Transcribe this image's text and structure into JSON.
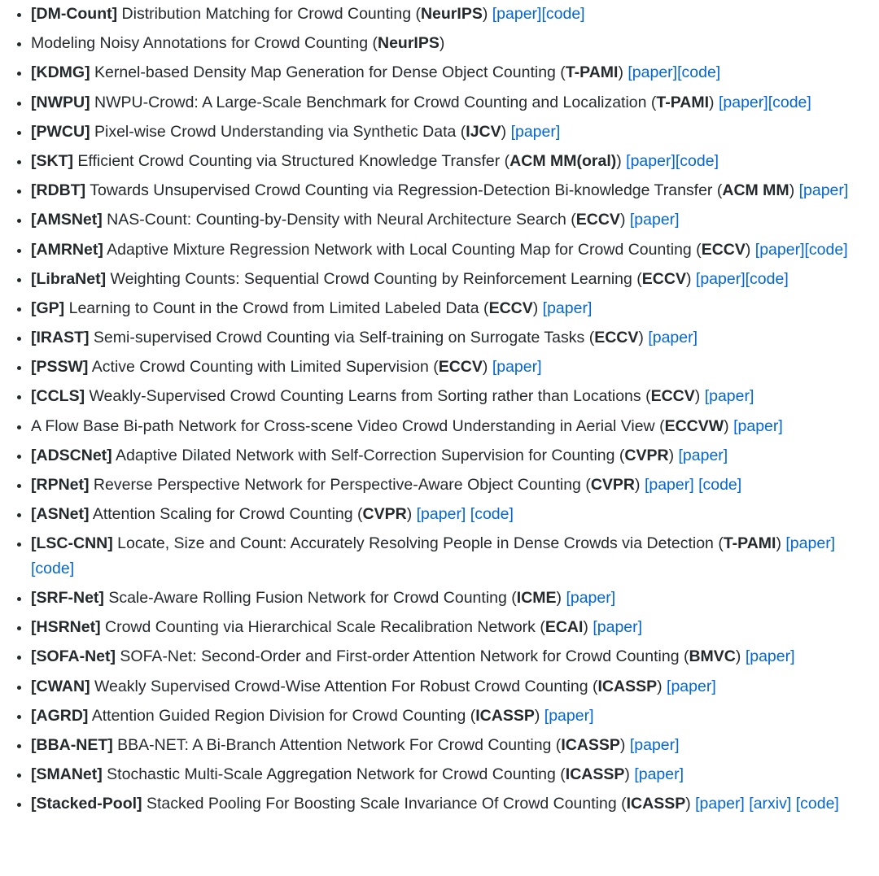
{
  "papers": [
    {
      "tag": "DM-Count",
      "title": "Distribution Matching for Crowd Counting",
      "venue": "NeurIPS",
      "links": [
        "paper",
        "code"
      ],
      "link_gap": false
    },
    {
      "tag": "",
      "title": "Modeling Noisy Annotations for Crowd Counting",
      "venue": "NeurIPS",
      "links": [],
      "link_gap": false
    },
    {
      "tag": "KDMG",
      "title": "Kernel-based Density Map Generation for Dense Object Counting",
      "venue": "T-PAMI",
      "links": [
        "paper",
        "code"
      ],
      "link_gap": false
    },
    {
      "tag": "NWPU",
      "title": "NWPU-Crowd: A Large-Scale Benchmark for Crowd Counting and Localization",
      "venue": "T-PAMI",
      "links": [
        "paper",
        "code"
      ],
      "link_gap": false
    },
    {
      "tag": "PWCU",
      "title": "Pixel-wise Crowd Understanding via Synthetic Data",
      "venue": "IJCV",
      "links": [
        "paper"
      ],
      "link_gap": false
    },
    {
      "tag": "SKT",
      "title": "Efficient Crowd Counting via Structured Knowledge Transfer",
      "venue": "ACM MM(oral)",
      "links": [
        "paper",
        "code"
      ],
      "link_gap": false
    },
    {
      "tag": "RDBT",
      "title": "Towards Unsupervised Crowd Counting via Regression-Detection Bi-knowledge Transfer",
      "venue": "ACM MM",
      "links": [
        "paper"
      ],
      "link_gap": false
    },
    {
      "tag": "AMSNet",
      "title": "NAS-Count: Counting-by-Density with Neural Architecture Search",
      "venue": "ECCV",
      "links": [
        "paper"
      ],
      "link_gap": false
    },
    {
      "tag": "AMRNet",
      "title": "Adaptive Mixture Regression Network with Local Counting Map for Crowd Counting",
      "venue": "ECCV",
      "links": [
        "paper",
        "code"
      ],
      "link_gap": false
    },
    {
      "tag": "LibraNet",
      "title": "Weighting Counts: Sequential Crowd Counting by Reinforcement Learning",
      "venue": "ECCV",
      "links": [
        "paper",
        "code"
      ],
      "link_gap": false
    },
    {
      "tag": "GP",
      "title": "Learning to Count in the Crowd from Limited Labeled Data",
      "venue": "ECCV",
      "links": [
        "paper"
      ],
      "link_gap": false
    },
    {
      "tag": "IRAST",
      "title": "Semi-supervised Crowd Counting via Self-training on Surrogate Tasks",
      "venue": "ECCV",
      "links": [
        "paper"
      ],
      "link_gap": false
    },
    {
      "tag": "PSSW",
      "title": "Active Crowd Counting with Limited Supervision",
      "venue": "ECCV",
      "links": [
        "paper"
      ],
      "link_gap": false
    },
    {
      "tag": "CCLS",
      "title": "Weakly-Supervised Crowd Counting Learns from Sorting rather than Locations",
      "venue": "ECCV",
      "links": [
        "paper"
      ],
      "link_gap": false
    },
    {
      "tag": "",
      "title": "A Flow Base Bi-path Network for Cross-scene Video Crowd Understanding in Aerial View",
      "venue": "ECCVW",
      "links": [
        "paper"
      ],
      "link_gap": false
    },
    {
      "tag": "ADSCNet",
      "title": "Adaptive Dilated Network with Self-Correction Supervision for Counting",
      "venue": "CVPR",
      "links": [
        "paper"
      ],
      "link_gap": false
    },
    {
      "tag": "RPNet",
      "title": "Reverse Perspective Network for Perspective-Aware Object Counting",
      "venue": "CVPR",
      "links": [
        "paper",
        "code"
      ],
      "link_gap": true
    },
    {
      "tag": "ASNet",
      "title": "Attention Scaling for Crowd Counting",
      "venue": "CVPR",
      "links": [
        "paper",
        "code"
      ],
      "link_gap": true
    },
    {
      "tag": "LSC-CNN",
      "title": "Locate, Size and Count: Accurately Resolving People in Dense Crowds via Detection",
      "venue": "T-PAMI",
      "links": [
        "paper",
        "code"
      ],
      "link_gap": false
    },
    {
      "tag": "SRF-Net",
      "title": "Scale-Aware Rolling Fusion Network for Crowd Counting",
      "venue": "ICME",
      "links": [
        "paper"
      ],
      "link_gap": false
    },
    {
      "tag": "HSRNet",
      "title": "Crowd Counting via Hierarchical Scale Recalibration Network",
      "venue": "ECAI",
      "links": [
        "paper"
      ],
      "link_gap": false
    },
    {
      "tag": "SOFA-Net",
      "title": "SOFA-Net: Second-Order and First-order Attention Network for Crowd Counting",
      "venue": "BMVC",
      "links": [
        "paper"
      ],
      "link_gap": false
    },
    {
      "tag": "CWAN",
      "title": "Weakly Supervised Crowd-Wise Attention For Robust Crowd Counting",
      "venue": "ICASSP",
      "links": [
        "paper"
      ],
      "link_gap": false
    },
    {
      "tag": "AGRD",
      "title": "Attention Guided Region Division for Crowd Counting",
      "venue": "ICASSP",
      "links": [
        "paper"
      ],
      "link_gap": false
    },
    {
      "tag": "BBA-NET",
      "title": "BBA-NET: A Bi-Branch Attention Network For Crowd Counting",
      "venue": "ICASSP",
      "links": [
        "paper"
      ],
      "link_gap": false
    },
    {
      "tag": "SMANet",
      "title": "Stochastic Multi-Scale Aggregation Network for Crowd Counting",
      "venue": "ICASSP",
      "links": [
        "paper"
      ],
      "link_gap": false
    },
    {
      "tag": "Stacked-Pool",
      "title": "Stacked Pooling For Boosting Scale Invariance Of Crowd Counting",
      "venue": "ICASSP",
      "links": [
        "paper",
        "arxiv",
        "code"
      ],
      "link_gap": true
    }
  ]
}
